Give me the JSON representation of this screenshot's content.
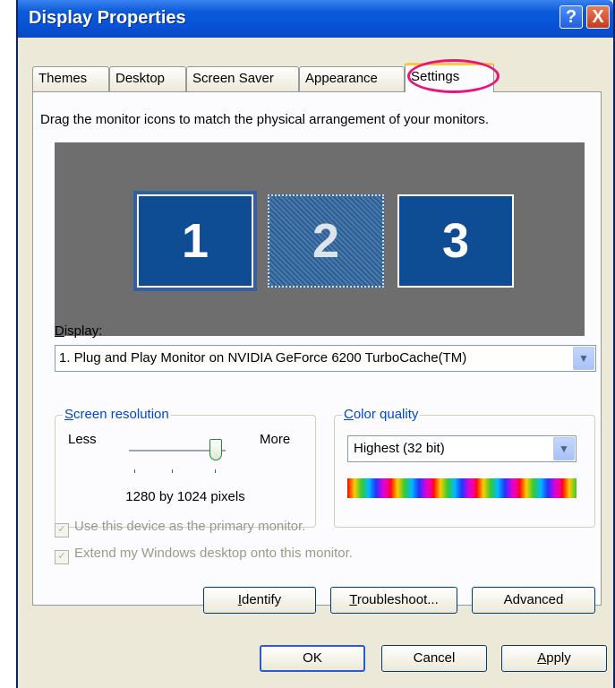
{
  "window": {
    "title": "Display Properties",
    "help_glyph": "?",
    "close_glyph": "X"
  },
  "tabs": [
    "Themes",
    "Desktop",
    "Screen Saver",
    "Appearance",
    "Settings"
  ],
  "active_tab": "Settings",
  "settings": {
    "instructions": "Drag the monitor icons to match the physical arrangement of your monitors.",
    "monitors": [
      "1",
      "2",
      "3"
    ],
    "display_label": "Display:",
    "display_value": "1. Plug and Play Monitor on NVIDIA GeForce 6200 TurboCache(TM)",
    "resolution": {
      "legend": "Screen resolution",
      "less": "Less",
      "more": "More",
      "value": "1280 by 1024 pixels",
      "slider_level": 0.95
    },
    "color_quality": {
      "legend": "Color quality",
      "value": "Highest (32 bit)"
    },
    "checkboxes": [
      {
        "label": "Use this device as the primary monitor.",
        "checked": true,
        "enabled": false
      },
      {
        "label": "Extend my Windows desktop onto this monitor.",
        "checked": true,
        "enabled": false
      }
    ],
    "buttons": {
      "identify": "Identify",
      "troubleshoot": "Troubleshoot...",
      "advanced": "Advanced"
    }
  },
  "footer": {
    "ok": "OK",
    "cancel": "Cancel",
    "apply": "Apply"
  },
  "colors": {
    "titlebar": "#0752d6",
    "highlight_ring": "#e5157d",
    "monitor_blue": "#0e4c93"
  },
  "icons": {
    "dropdown": "chevron-down-icon",
    "checkbox": "check-icon"
  }
}
